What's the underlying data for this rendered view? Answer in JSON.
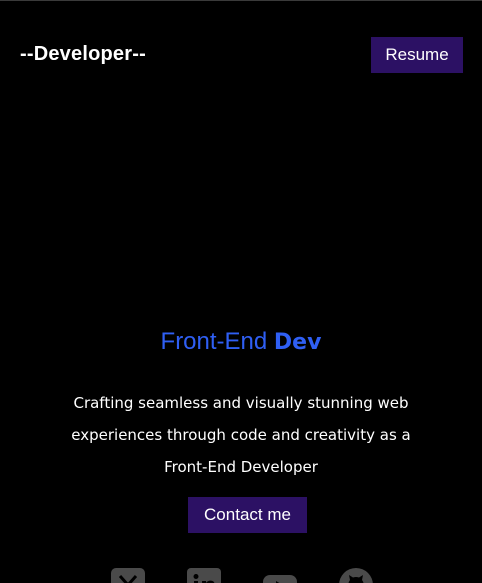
{
  "navbar": {
    "brand": "--Developer--",
    "resume_label": "Resume"
  },
  "hero": {
    "role_light": "Front-End",
    "role_bold": "Dev",
    "tagline": "Crafting seamless and visually stunning web experiences through code and creativity as a Front-End Developer",
    "contact_label": "Contact me"
  },
  "socials": [
    {
      "icon": "x-twitter-icon"
    },
    {
      "icon": "linkedin-icon"
    },
    {
      "icon": "youtube-icon"
    },
    {
      "icon": "github-icon"
    }
  ],
  "colors": {
    "background": "#000000",
    "button": "#2c1164",
    "accent": "#2f5ff4",
    "icon": "#4a4a4a"
  }
}
